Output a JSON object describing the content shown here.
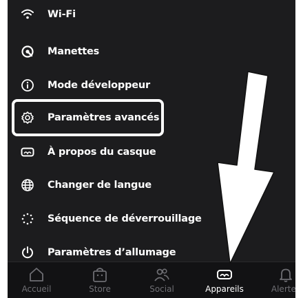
{
  "menu": {
    "items": [
      {
        "label": "Wi-Fi",
        "icon": "wifi-icon"
      },
      {
        "label": "Manettes",
        "icon": "controller-icon"
      },
      {
        "label": "Mode développeur",
        "icon": "info-icon"
      },
      {
        "label": "Paramètres avancés",
        "icon": "gear-icon"
      },
      {
        "label": "À propos du casque",
        "icon": "headset-icon"
      },
      {
        "label": "Changer de langue",
        "icon": "globe-icon"
      },
      {
        "label": "Séquence de déverrouillage",
        "icon": "unlock-pattern-icon"
      },
      {
        "label": "Paramètres d’allumage",
        "icon": "power-icon"
      }
    ],
    "highlighted": "Paramètres avancés"
  },
  "tabbar": {
    "tabs": [
      {
        "label": "Accueil",
        "icon": "home-icon"
      },
      {
        "label": "Store",
        "icon": "store-icon"
      },
      {
        "label": "Social",
        "icon": "people-icon"
      },
      {
        "label": "Appareils",
        "icon": "headset-icon"
      },
      {
        "label": "Alertes",
        "icon": "bell-icon"
      }
    ],
    "active": "Appareils"
  },
  "colors": {
    "background": "#1c1c1e",
    "text": "#ffffff",
    "tab_inactive": "#6e6e73",
    "tab_active": "#ffffff",
    "annotation": "#ffffff"
  }
}
